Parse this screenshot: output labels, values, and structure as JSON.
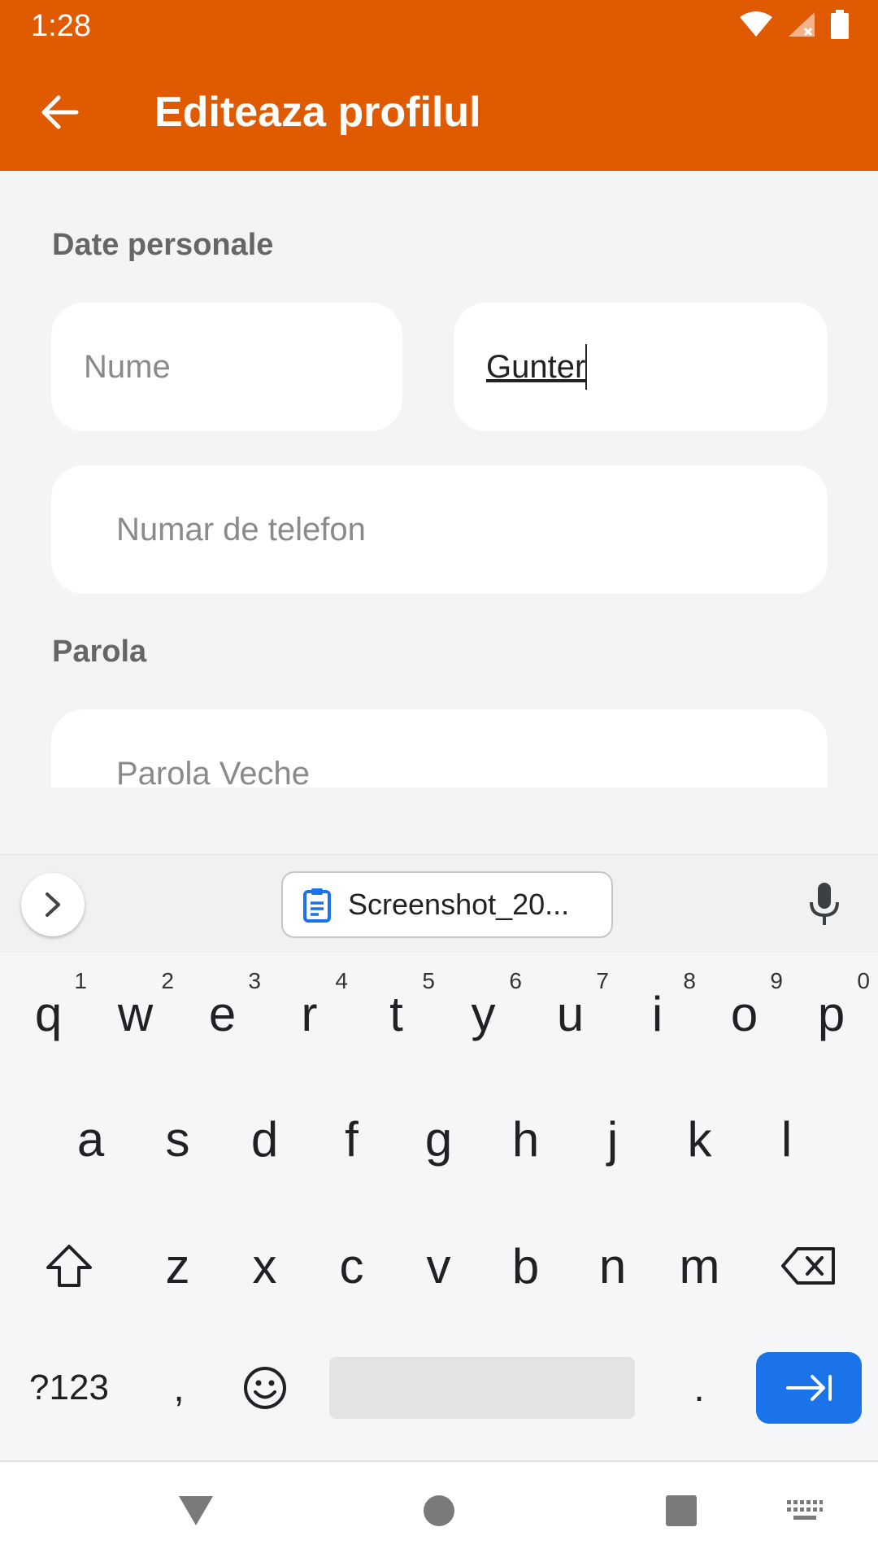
{
  "status": {
    "time": "1:28",
    "icons": [
      "wifi-icon",
      "signal-icon",
      "battery-icon"
    ]
  },
  "appbar": {
    "title": "Editeaza profilul",
    "back_icon": "arrow-left-icon",
    "color": "#df5a00"
  },
  "form": {
    "section_personal": "Date personale",
    "first_name_placeholder": "Nume",
    "last_name_value": "Gunter",
    "phone_placeholder": "Numar de telefon",
    "section_password": "Parola",
    "old_password_placeholder": "Parola Veche"
  },
  "keyboard": {
    "clipboard_chip": "Screenshot_20...",
    "row1": [
      {
        "k": "q",
        "n": "1"
      },
      {
        "k": "w",
        "n": "2"
      },
      {
        "k": "e",
        "n": "3"
      },
      {
        "k": "r",
        "n": "4"
      },
      {
        "k": "t",
        "n": "5"
      },
      {
        "k": "y",
        "n": "6"
      },
      {
        "k": "u",
        "n": "7"
      },
      {
        "k": "i",
        "n": "8"
      },
      {
        "k": "o",
        "n": "9"
      },
      {
        "k": "p",
        "n": "0"
      }
    ],
    "row2": [
      "a",
      "s",
      "d",
      "f",
      "g",
      "h",
      "j",
      "k",
      "l"
    ],
    "row3": [
      "z",
      "x",
      "c",
      "v",
      "b",
      "n",
      "m"
    ],
    "symbols_key": "?123",
    "comma_key": ",",
    "period_key": ".",
    "enter_color": "#1a73e8"
  }
}
